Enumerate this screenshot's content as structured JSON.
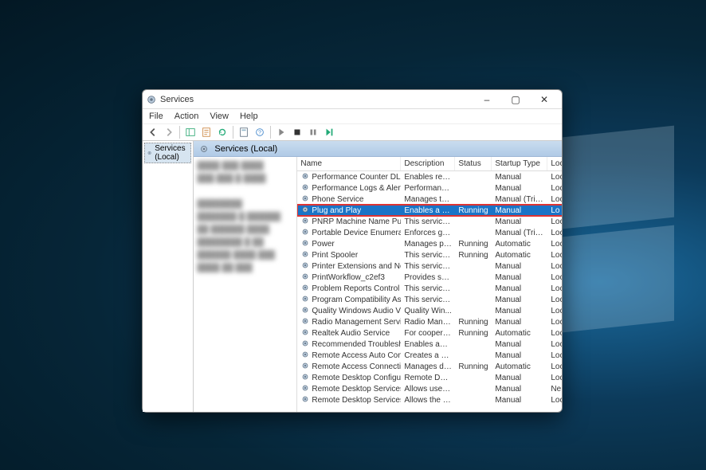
{
  "window": {
    "title": "Services",
    "minimize": "–",
    "maximize": "▢",
    "close": "✕"
  },
  "menu": {
    "file": "File",
    "action": "Action",
    "view": "View",
    "help": "Help"
  },
  "sidebar": {
    "root": "Services (Local)"
  },
  "panel": {
    "title": "Services (Local)"
  },
  "columns": {
    "name": "Name",
    "description": "Description",
    "status": "Status",
    "startup": "Startup Type",
    "logon": "Loc"
  },
  "services": [
    {
      "name": "Performance Counter DLL H...",
      "desc": "Enables rem...",
      "status": "",
      "startup": "Manual",
      "logon": "Loc"
    },
    {
      "name": "Performance Logs & Alerts",
      "desc": "Performanc...",
      "status": "",
      "startup": "Manual",
      "logon": "Loc"
    },
    {
      "name": "Phone Service",
      "desc": "Manages th...",
      "status": "",
      "startup": "Manual (Trigg...",
      "logon": "Loc"
    },
    {
      "name": "Plug and Play",
      "desc": "Enables a co...",
      "status": "Running",
      "startup": "Manual",
      "logon": "Lo",
      "selected": true
    },
    {
      "name": "PNRP Machine Name Public...",
      "desc": "This service ...",
      "status": "",
      "startup": "Manual",
      "logon": "Loc"
    },
    {
      "name": "Portable Device Enumerator",
      "desc": "Enforces gro...",
      "status": "",
      "startup": "Manual (Trigg...",
      "logon": "Loc"
    },
    {
      "name": "Power",
      "desc": "Manages po...",
      "status": "Running",
      "startup": "Automatic",
      "logon": "Loc"
    },
    {
      "name": "Print Spooler",
      "desc": "This service ...",
      "status": "Running",
      "startup": "Automatic",
      "logon": "Loc"
    },
    {
      "name": "Printer Extensions and Notifi...",
      "desc": "This service ...",
      "status": "",
      "startup": "Manual",
      "logon": "Loc"
    },
    {
      "name": "PrintWorkflow_c2ef3",
      "desc": "Provides sup...",
      "status": "",
      "startup": "Manual",
      "logon": "Loc"
    },
    {
      "name": "Problem Reports Control Pa...",
      "desc": "This service ...",
      "status": "",
      "startup": "Manual",
      "logon": "Loc"
    },
    {
      "name": "Program Compatibility Assis...",
      "desc": "This service ...",
      "status": "",
      "startup": "Manual",
      "logon": "Loc"
    },
    {
      "name": "Quality Windows Audio Vid...",
      "desc": "Quality Win...",
      "status": "",
      "startup": "Manual",
      "logon": "Loc"
    },
    {
      "name": "Radio Management Service",
      "desc": "Radio Mana...",
      "status": "Running",
      "startup": "Manual",
      "logon": "Loc"
    },
    {
      "name": "Realtek Audio Service",
      "desc": "For cooperat...",
      "status": "Running",
      "startup": "Automatic",
      "logon": "Loc"
    },
    {
      "name": "Recommended Troubleshoo...",
      "desc": "Enables aut...",
      "status": "",
      "startup": "Manual",
      "logon": "Loc"
    },
    {
      "name": "Remote Access Auto Conne...",
      "desc": "Creates a co...",
      "status": "",
      "startup": "Manual",
      "logon": "Loc"
    },
    {
      "name": "Remote Access Connection ...",
      "desc": "Manages di...",
      "status": "Running",
      "startup": "Automatic",
      "logon": "Loc"
    },
    {
      "name": "Remote Desktop Configurati...",
      "desc": "Remote Des...",
      "status": "",
      "startup": "Manual",
      "logon": "Loc"
    },
    {
      "name": "Remote Desktop Services",
      "desc": "Allows users ...",
      "status": "",
      "startup": "Manual",
      "logon": "Ne"
    },
    {
      "name": "Remote Desktop Services Us...",
      "desc": "Allows the re...",
      "status": "",
      "startup": "Manual",
      "logon": "Loc"
    }
  ]
}
